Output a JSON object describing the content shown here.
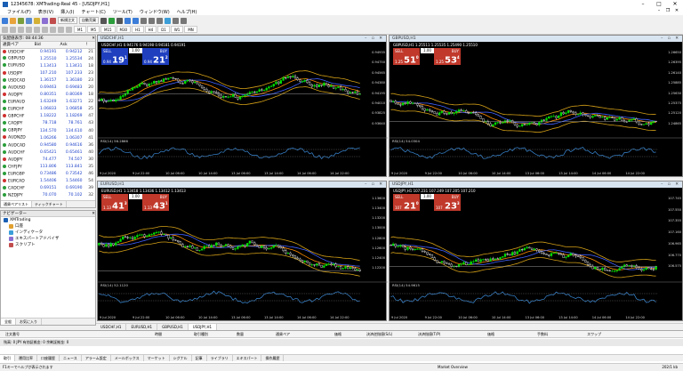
{
  "window": {
    "title": "12345678: XMTrading-Real 45 - [USDJPY,H1]"
  },
  "menu": [
    "ファイル(F)",
    "表示(V)",
    "挿入(I)",
    "チャート(C)",
    "ツール(T)",
    "ウィンドウ(W)",
    "ヘルプ(H)"
  ],
  "toolbar": {
    "new_order": "新規注文",
    "auto_trade": "自動売買",
    "timeframes": [
      "M1",
      "M5",
      "M15",
      "M30",
      "H1",
      "H4",
      "D1",
      "W1",
      "MN"
    ]
  },
  "market_watch": {
    "title": "気配値表示: 08:44:36",
    "columns": [
      "通貨ペア",
      "Bid",
      "Ask",
      "!"
    ],
    "rows": [
      {
        "symbol": "USDCHF",
        "bid": "0.94191",
        "ask": "0.94212",
        "spread": "21"
      },
      {
        "symbol": "GBPUSD",
        "bid": "1.25510",
        "ask": "1.25534",
        "spread": "24"
      },
      {
        "symbol": "EURUSD",
        "bid": "1.13413",
        "ask": "1.13431",
        "spread": "18"
      },
      {
        "symbol": "USDJPY",
        "bid": "107.210",
        "ask": "107.233",
        "spread": "23"
      },
      {
        "symbol": "USDCAD",
        "bid": "1.36157",
        "ask": "1.36180",
        "spread": "23"
      },
      {
        "symbol": "AUDUSD",
        "bid": "0.69463",
        "ask": "0.69483",
        "spread": "20"
      },
      {
        "symbol": "AUDJPY",
        "bid": "0.80351",
        "ask": "0.80369",
        "spread": "18"
      },
      {
        "symbol": "EURAUD",
        "bid": "1.63249",
        "ask": "1.63271",
        "spread": "22"
      },
      {
        "symbol": "EURCHF",
        "bid": "1.06833",
        "ask": "1.06858",
        "spread": "25"
      },
      {
        "symbol": "GBPCHF",
        "bid": "1.18222",
        "ask": "1.18269",
        "spread": "47"
      },
      {
        "symbol": "CADJPY",
        "bid": "78.718",
        "ask": "78.761",
        "spread": "43"
      },
      {
        "symbol": "GBPJPY",
        "bid": "134.570",
        "ask": "134.610",
        "spread": "40"
      },
      {
        "symbol": "AUDNZD",
        "bid": "1.06266",
        "ask": "1.06307",
        "spread": "41"
      },
      {
        "symbol": "AUDCAD",
        "bid": "0.94580",
        "ask": "0.94616",
        "spread": "36"
      },
      {
        "symbol": "AUDCHF",
        "bid": "0.65421",
        "ask": "0.65461",
        "spread": "40"
      },
      {
        "symbol": "AUDJPY",
        "bid": "74.477",
        "ask": "74.507",
        "spread": "30"
      },
      {
        "symbol": "CHFJPY",
        "bid": "113.806",
        "ask": "113.841",
        "spread": "35"
      },
      {
        "symbol": "EURGBP",
        "bid": "0.73486",
        "ask": "0.73542",
        "spread": "46"
      },
      {
        "symbol": "EURCAD",
        "bid": "1.54406",
        "ask": "1.54460",
        "spread": "54"
      },
      {
        "symbol": "CADCHF",
        "bid": "0.69151",
        "ask": "0.69190",
        "spread": "39"
      },
      {
        "symbol": "NZDJPY",
        "bid": "70.070",
        "ask": "70.102",
        "spread": "32"
      },
      {
        "symbol": "NZDUSD",
        "bid": "0.65351",
        "ask": "0.65376",
        "spread": "25"
      }
    ],
    "tabs": [
      "通貨ペアリスト",
      "ティックチャート"
    ]
  },
  "navigator": {
    "title": "ナビゲーター",
    "items": [
      "XMTrading",
      "口座",
      "インディケータ",
      "エキスパートアドバイザ",
      "スクリプト"
    ],
    "tabs": [
      "全般",
      "お気に入り"
    ]
  },
  "charts": [
    {
      "id": "usdchf",
      "title": "USDCHF,H1",
      "info": "USDCHF,H1  0.94176 0.94198 0.94181 0.94191",
      "sell_big": "19",
      "sell_sup": "1",
      "buy_big": "21",
      "buy_sup": "2",
      "sell_price": "0.94",
      "buy_price": "0.94",
      "lot": "1.00",
      "theme": "blue",
      "rsi": "RSI(14) 56.2866",
      "y_labels": [
        "0.94935",
        "0.94750",
        "0.94565",
        "0.94380",
        "0.94195",
        "0.94010",
        "0.93825",
        "0.93640"
      ],
      "x_labels": [
        "9 Jul 2020",
        "9 Jul 22:00",
        "10 Jul 06:00",
        "10 Jul 14:00",
        "13 Jul 06:00",
        "13 Jul 14:00",
        "14 Jul 06:00",
        "14 Jul 22:00"
      ]
    },
    {
      "id": "gbpusd",
      "title": "GBPUSD,H1",
      "info": "GBPUSD,H1  1.25511 1.25535 1.25490 1.25510",
      "sell_big": "51",
      "sell_sup": "0",
      "buy_big": "53",
      "buy_sup": "4",
      "sell_price": "1.25",
      "buy_price": "1.25",
      "lot": "1.00",
      "theme": "red",
      "rsi": "RSI(14) 54.0304",
      "y_labels": [
        "1.26650",
        "1.26395",
        "1.26140",
        "1.25885",
        "1.25630",
        "1.25375",
        "1.25120",
        "1.24865"
      ],
      "x_labels": [
        "9 Jul 2020",
        "9 Jul 22:00",
        "10 Jul 06:00",
        "10 Jul 14:00",
        "13 Jul 06:00",
        "13 Jul 14:00",
        "14 Jul 06:00",
        "14 Jul 22:00"
      ]
    },
    {
      "id": "eurusd",
      "title": "EURUSD,H1",
      "info": "EURUSD,H1  1.13418 1.13436 1.13412 1.13413",
      "sell_big": "41",
      "sell_sup": "3",
      "buy_big": "43",
      "buy_sup": "1",
      "sell_price": "1.13",
      "buy_price": "1.13",
      "lot": "1.00",
      "theme": "red",
      "rsi": "RSI(14) 52.1120",
      "y_labels": [
        "1.13600",
        "1.13400",
        "1.13200",
        "1.13000",
        "1.12800",
        "1.12600",
        "1.12400",
        "1.12200"
      ],
      "x_labels": [
        "9 Jul 2020",
        "9 Jul 22:00",
        "10 Jul 06:00",
        "10 Jul 14:00",
        "13 Jul 06:00",
        "13 Jul 14:00",
        "14 Jul 06:00",
        "14 Jul 22:00"
      ]
    },
    {
      "id": "usdjpy",
      "title": "USDJPY,H1",
      "info": "USDJPY,H1  107.231 107.249 107.205 107.210",
      "sell_big": "21",
      "sell_sup": "0",
      "buy_big": "23",
      "buy_sup": "3",
      "sell_price": "107",
      "buy_price": "107",
      "lot": "1.00",
      "theme": "red",
      "rsi": "RSI(14) 54.9615",
      "y_labels": [
        "107.745",
        "107.550",
        "107.355",
        "107.160",
        "106.965",
        "106.770",
        "106.575"
      ],
      "x_labels": [
        "9 Jul 2020",
        "9 Jul 22:00",
        "10 Jul 06:00",
        "10 Jul 14:00",
        "13 Jul 06:00",
        "13 Jul 14:00",
        "14 Jul 06:00",
        "14 Jul 22:00"
      ]
    }
  ],
  "chart_tabs": [
    "USDCHF,H1",
    "EURUSD,H1",
    "GBPUSD,H1",
    "USDJPY,H1"
  ],
  "terminal": {
    "columns": [
      "注文番号",
      "時間",
      "取引種別",
      "数量",
      "通貨ペア",
      "価格",
      "決済逆指値(S/L)",
      "決済指値(T/P)",
      "価格",
      "手数料",
      "スワップ"
    ],
    "balance_row": "残高: 0 JPY  有効証拠金: 0  余剰証拠金: 0",
    "tabs": [
      "取引",
      "運用比率",
      "口座履歴",
      "ニュース",
      "アラーム設定",
      "メールボックス",
      "マーケット",
      "シグナル",
      "記事",
      "ライブラリ",
      "エキスパート",
      "操作履歴"
    ]
  },
  "status": {
    "help": "F1キーでヘルプが表示されます",
    "profile": "Market Overview",
    "traffic": "202/1 kb"
  },
  "colors": {
    "bull": "#00e000",
    "bear": "#f0f0f0",
    "band": "#d4a017",
    "ma": "#ff8c00",
    "sell_red": "#c0392b",
    "sell_blue": "#1f3fbf"
  }
}
